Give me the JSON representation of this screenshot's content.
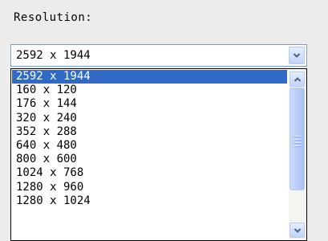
{
  "field": {
    "label": "Resolution:"
  },
  "combo": {
    "selected_value": "2592 x 1944",
    "icon": "chevron-down-icon"
  },
  "dropdown": {
    "options": [
      "2592 x 1944",
      "160 x 120",
      "176 x 144",
      "320 x 240",
      "352 x 288",
      "640 x 480",
      "800 x 600",
      "1024 x 768",
      "1280 x 960",
      "1280 x 1024"
    ],
    "highlighted_index": 0
  },
  "colors": {
    "highlight": "#316ac5",
    "border": "#7f9db9",
    "button_accent": "#4d6185"
  }
}
